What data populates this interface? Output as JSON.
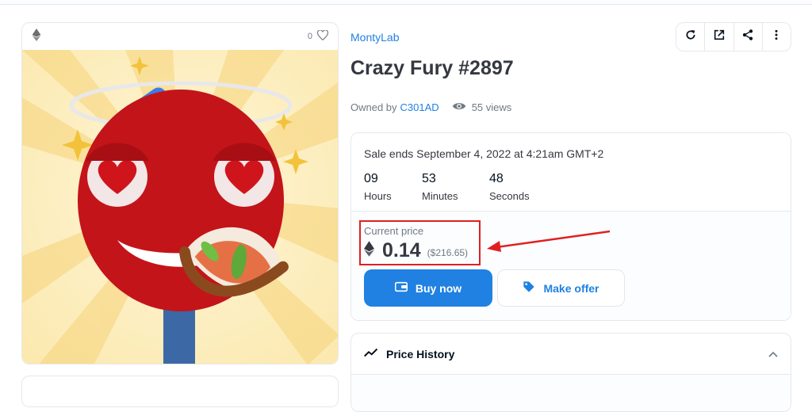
{
  "card": {
    "favorites_count": "0"
  },
  "collection_name": "MontyLab",
  "title": "Crazy Fury #2897",
  "owner": {
    "prefix": "Owned by",
    "name": "C301AD"
  },
  "views": "55 views",
  "sale": {
    "ends_text": "Sale ends September 4, 2022 at 4:21am GMT+2",
    "timer": [
      {
        "value": "09",
        "label": "Hours"
      },
      {
        "value": "53",
        "label": "Minutes"
      },
      {
        "value": "48",
        "label": "Seconds"
      }
    ],
    "price_label": "Current price",
    "price": "0.14",
    "price_usd": "($216.65)",
    "buy_label": "Buy now",
    "offer_label": "Make offer"
  },
  "price_history": {
    "title": "Price History"
  },
  "colors": {
    "accent": "#2081e2",
    "highlight": "#e02020"
  },
  "icons": [
    "ethereum-icon",
    "heart-icon",
    "refresh-icon",
    "external-link-icon",
    "share-icon",
    "more-icon",
    "eye-icon",
    "wallet-icon",
    "tag-icon",
    "trend-icon",
    "chevron-up-icon"
  ]
}
